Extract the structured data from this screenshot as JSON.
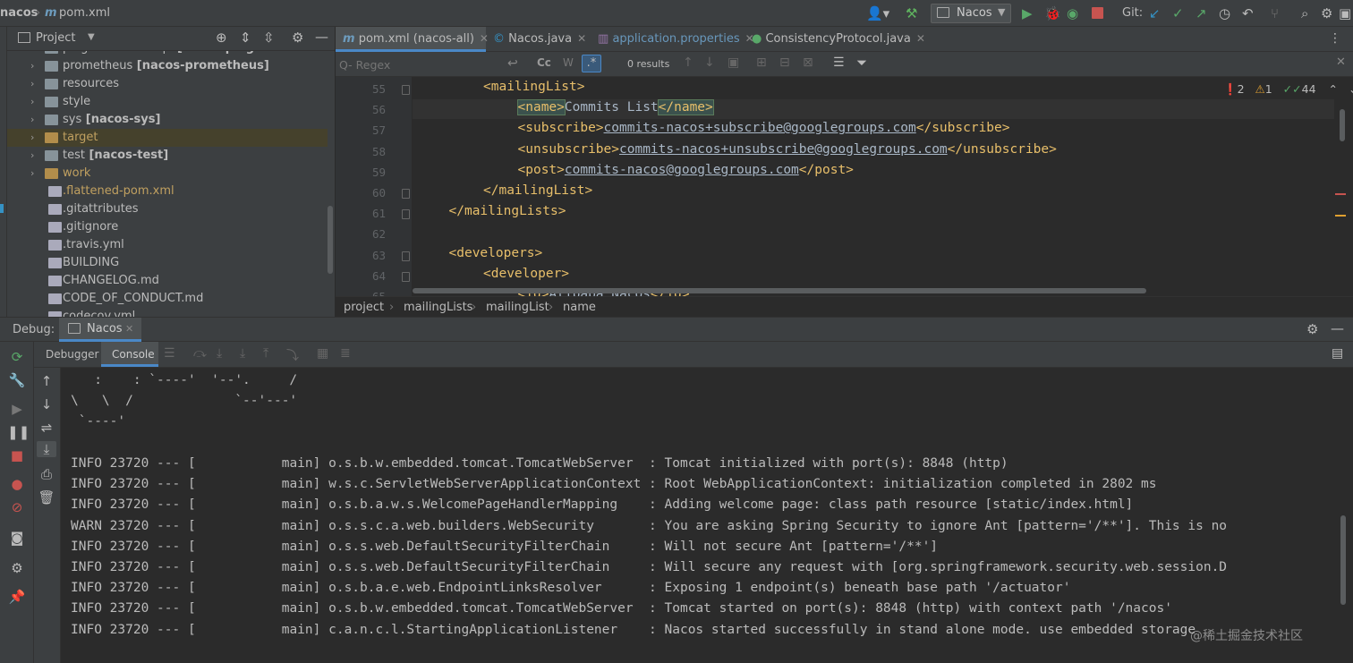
{
  "topbar": {
    "project": "nacos",
    "file": "pom.xml",
    "run_config": "Nacos",
    "git_label": "Git:"
  },
  "project_panel": {
    "title": "Project",
    "items": [
      {
        "name": "plugin-default-impl",
        "module": "[nacos-plugin-default-impl]",
        "type": "folder"
      },
      {
        "name": "prometheus",
        "module": "[nacos-prometheus]",
        "type": "folder"
      },
      {
        "name": "resources",
        "module": "",
        "type": "folder"
      },
      {
        "name": "style",
        "module": "",
        "type": "folder"
      },
      {
        "name": "sys",
        "module": "[nacos-sys]",
        "type": "folder"
      },
      {
        "name": "target",
        "module": "",
        "type": "folder-orange"
      },
      {
        "name": "test",
        "module": "[nacos-test]",
        "type": "folder"
      },
      {
        "name": "work",
        "module": "",
        "type": "folder-orange"
      },
      {
        "name": ".flattened-pom.xml",
        "module": "",
        "type": "file"
      },
      {
        "name": ".gitattributes",
        "module": "",
        "type": "file"
      },
      {
        "name": ".gitignore",
        "module": "",
        "type": "file"
      },
      {
        "name": ".travis.yml",
        "module": "",
        "type": "file"
      },
      {
        "name": "BUILDING",
        "module": "",
        "type": "file"
      },
      {
        "name": "CHANGELOG.md",
        "module": "",
        "type": "file"
      },
      {
        "name": "CODE_OF_CONDUCT.md",
        "module": "",
        "type": "file"
      },
      {
        "name": "codecov.yml",
        "module": "",
        "type": "file"
      }
    ]
  },
  "editor": {
    "tabs": [
      {
        "label": "pom.xml (nacos-all)",
        "active": true
      },
      {
        "label": "Nacos.java",
        "active": false
      },
      {
        "label": "application.properties",
        "active": false
      },
      {
        "label": "ConsistencyProtocol.java",
        "active": false
      }
    ],
    "search": {
      "placeholder": "Q- Regex",
      "results": "0 results"
    },
    "inspections": {
      "errors": "2",
      "warnings": "1",
      "ok": "44"
    },
    "lines": [
      {
        "num": "55",
        "indent": 3,
        "tag": "<mailingList>",
        "text": "",
        "close": "",
        "url": false
      },
      {
        "num": "56",
        "indent": 4,
        "tag": "<name>",
        "text": "Commits List",
        "close": "</name>",
        "url": false
      },
      {
        "num": "57",
        "indent": 4,
        "tag": "<subscribe>",
        "text": "commits-nacos+subscribe@googlegroups.com",
        "close": "</subscribe>",
        "url": true
      },
      {
        "num": "58",
        "indent": 4,
        "tag": "<unsubscribe>",
        "text": "commits-nacos+unsubscribe@googlegroups.com",
        "close": "</unsubscribe>",
        "url": true
      },
      {
        "num": "59",
        "indent": 4,
        "tag": "<post>",
        "text": "commits-nacos@googlegroups.com",
        "close": "</post>",
        "url": true
      },
      {
        "num": "60",
        "indent": 3,
        "tag": "</mailingList>",
        "text": "",
        "close": "",
        "url": false
      },
      {
        "num": "61",
        "indent": 2,
        "tag": "</mailingLists>",
        "text": "",
        "close": "",
        "url": false
      },
      {
        "num": "62",
        "indent": 0,
        "tag": "",
        "text": "",
        "close": "",
        "url": false
      },
      {
        "num": "63",
        "indent": 2,
        "tag": "<developers>",
        "text": "",
        "close": "",
        "url": false
      },
      {
        "num": "64",
        "indent": 3,
        "tag": "<developer>",
        "text": "",
        "close": "",
        "url": false
      },
      {
        "num": "65",
        "indent": 4,
        "tag": "<id>",
        "text": "Alibaba Nacos",
        "close": "</id>",
        "url": false
      }
    ],
    "breadcrumbs": [
      "project",
      "mailingLists",
      "mailingList",
      "name"
    ]
  },
  "debug": {
    "title": "Debug:",
    "config": "Nacos",
    "tabs": [
      "Debugger",
      "Console"
    ],
    "banner": [
      "   :    : `----'  '--'.     /",
      "\\   \\  /             `--'---'",
      " `----'"
    ],
    "log": [
      {
        "level": "INFO",
        "pid": "23720",
        "thread": "main",
        "logger": "o.s.b.w.embedded.tomcat.TomcatWebServer  ",
        "msg": "Tomcat initialized with port(s): 8848 (http)"
      },
      {
        "level": "INFO",
        "pid": "23720",
        "thread": "main",
        "logger": "w.s.c.ServletWebServerApplicationContext ",
        "msg": "Root WebApplicationContext: initialization completed in 2802 ms"
      },
      {
        "level": "INFO",
        "pid": "23720",
        "thread": "main",
        "logger": "o.s.b.a.w.s.WelcomePageHandlerMapping    ",
        "msg": "Adding welcome page: class path resource [static/index.html]"
      },
      {
        "level": "WARN",
        "pid": "23720",
        "thread": "main",
        "logger": "o.s.s.c.a.web.builders.WebSecurity       ",
        "msg": "You are asking Spring Security to ignore Ant [pattern='/**']. This is no"
      },
      {
        "level": "INFO",
        "pid": "23720",
        "thread": "main",
        "logger": "o.s.s.web.DefaultSecurityFilterChain     ",
        "msg": "Will not secure Ant [pattern='/**']"
      },
      {
        "level": "INFO",
        "pid": "23720",
        "thread": "main",
        "logger": "o.s.s.web.DefaultSecurityFilterChain     ",
        "msg": "Will secure any request with [org.springframework.security.web.session.D"
      },
      {
        "level": "INFO",
        "pid": "23720",
        "thread": "main",
        "logger": "o.s.b.a.e.web.EndpointLinksResolver      ",
        "msg": "Exposing 1 endpoint(s) beneath base path '/actuator'"
      },
      {
        "level": "INFO",
        "pid": "23720",
        "thread": "main",
        "logger": "o.s.b.w.embedded.tomcat.TomcatWebServer  ",
        "msg": "Tomcat started on port(s): 8848 (http) with context path '/nacos'"
      },
      {
        "level": "INFO",
        "pid": "23720",
        "thread": "main",
        "logger": "c.a.n.c.l.StartingApplicationListener    ",
        "msg": "Nacos started successfully in stand alone mode. use embedded storage"
      }
    ],
    "watermark": "@稀土掘金技术社区"
  }
}
